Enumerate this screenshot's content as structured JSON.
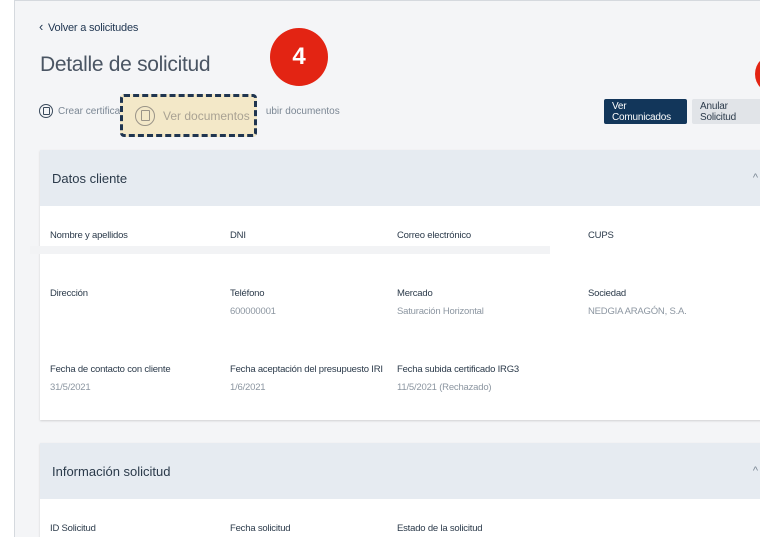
{
  "nav": {
    "back_label": "Volver a solicitudes",
    "back_icon": "chevron-left-icon"
  },
  "header": {
    "title": "Detalle de solicitud"
  },
  "actions": {
    "create_certificate": "Crear certificad",
    "view_documents": "Ver documentos",
    "upload_documents": "ubir documentos"
  },
  "buttons": {
    "view_communications": "Ver Comunicados",
    "cancel_request": "Anular Solicitud"
  },
  "step_badge": "4",
  "colors": {
    "primary": "#12365a",
    "badge": "#e32413",
    "highlight_bg": "#f3e8c8",
    "card_header": "#e6ebf1"
  },
  "client_card": {
    "title": "Datos cliente",
    "toggle": "^",
    "fields": {
      "name": {
        "label": "Nombre y apellidos",
        "value": ""
      },
      "dni": {
        "label": "DNI",
        "value": ""
      },
      "email": {
        "label": "Correo electrónico",
        "value": ""
      },
      "cups": {
        "label": "CUPS",
        "value": ""
      },
      "address": {
        "label": "Dirección",
        "value": ""
      },
      "phone": {
        "label": "Teléfono",
        "value": "600000001"
      },
      "market": {
        "label": "Mercado",
        "value": "Saturación Horizontal"
      },
      "company": {
        "label": "Sociedad",
        "value": "NEDGIA ARAGÓN, S.A."
      },
      "contact_date": {
        "label": "Fecha de contacto con cliente",
        "value": "31/5/2021"
      },
      "iri_date": {
        "label": "Fecha aceptación del presupuesto IRI",
        "value": "1/6/2021"
      },
      "irg3_date": {
        "label": "Fecha subida certificado IRG3",
        "value": "11/5/2021 (Rechazado)"
      }
    }
  },
  "request_card": {
    "title": "Información solicitud",
    "toggle": "^",
    "fields": {
      "id": {
        "label": "ID Solicitud"
      },
      "date": {
        "label": "Fecha solicitud"
      },
      "status": {
        "label": "Estado de la solicitud"
      }
    }
  }
}
